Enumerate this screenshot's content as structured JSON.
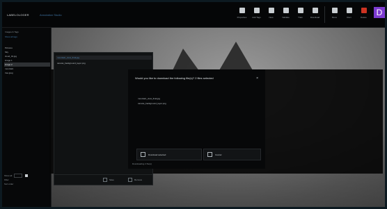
{
  "app": {
    "title": "LABELOLOGER",
    "subtitle": "Annotation Studio"
  },
  "toolbar": {
    "tools": [
      {
        "label": "Properties",
        "icon": "properties-icon"
      },
      {
        "label": "Add Tags",
        "icon": "tag-icon"
      },
      {
        "label": "New",
        "icon": "new-icon"
      },
      {
        "label": "Validate",
        "icon": "validate-icon"
      },
      {
        "label": "Train",
        "icon": "train-icon"
      },
      {
        "label": "Download",
        "icon": "download-icon"
      }
    ],
    "tools_right": [
      {
        "label": "Move",
        "icon": "move-icon"
      },
      {
        "label": "Rect",
        "icon": "rectangle-icon"
      },
      {
        "label": "Delete",
        "icon": "delete-icon",
        "active": true
      }
    ],
    "avatar_letter": "D"
  },
  "sidebar": {
    "header": "Images & Tags",
    "link": "Show all tags",
    "rows": [
      "Pictures",
      "Sky",
      "cloud_01.jpg",
      "image 1",
      "image 2",
      "mountain",
      "tree.jpeg"
    ],
    "selected_index": 4,
    "footer": [
      "Show all",
      "Filter",
      "Sort order"
    ]
  },
  "panel": {
    "items": [
      {
        "text": "mountain_view_final.jpg",
        "selected": true
      },
      {
        "text": "canvas_background_layer.png"
      }
    ],
    "buttons": [
      {
        "label": "Save",
        "icon": "save-icon"
      },
      {
        "label": "Remove",
        "icon": "remove-icon"
      }
    ]
  },
  "dialog": {
    "title": "Would you like to download the following file(s)? 2 files selected",
    "close": "×",
    "files": [
      "mountain_view_final.jpg",
      "canvas_background_layer.png"
    ],
    "primary_label": "Download selected",
    "secondary_label": "Cancel",
    "note": "Downloading 2 file(s)"
  }
}
